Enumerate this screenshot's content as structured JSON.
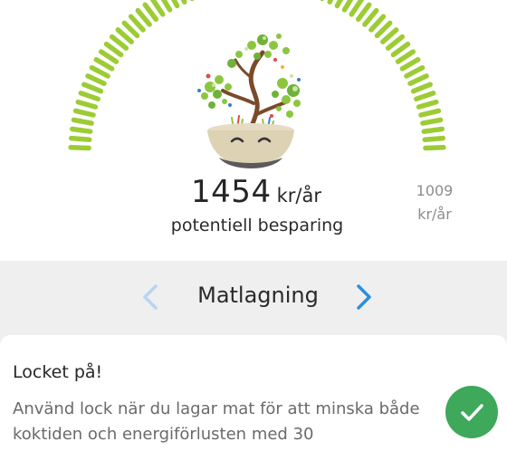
{
  "savings": {
    "amount": "1454",
    "unit": "kr/år",
    "caption": "potentiell besparing",
    "max_value": "1009",
    "max_unit": "kr/år"
  },
  "gauge": {
    "color": "#9ccc35",
    "icon": "savings-tree-in-pot"
  },
  "category_nav": {
    "title": "Matlagning",
    "prev_icon": "chevron-left-icon",
    "next_icon": "chevron-right-icon",
    "prev_color": "#b9d4ef",
    "next_color": "#2a8fe0"
  },
  "tip": {
    "title": "Locket på!",
    "body": "Använd lock när du lagar mat för att minska både koktiden och energiförlusten med 30",
    "done_icon": "checkmark-icon",
    "done_color": "#3ea85b"
  }
}
